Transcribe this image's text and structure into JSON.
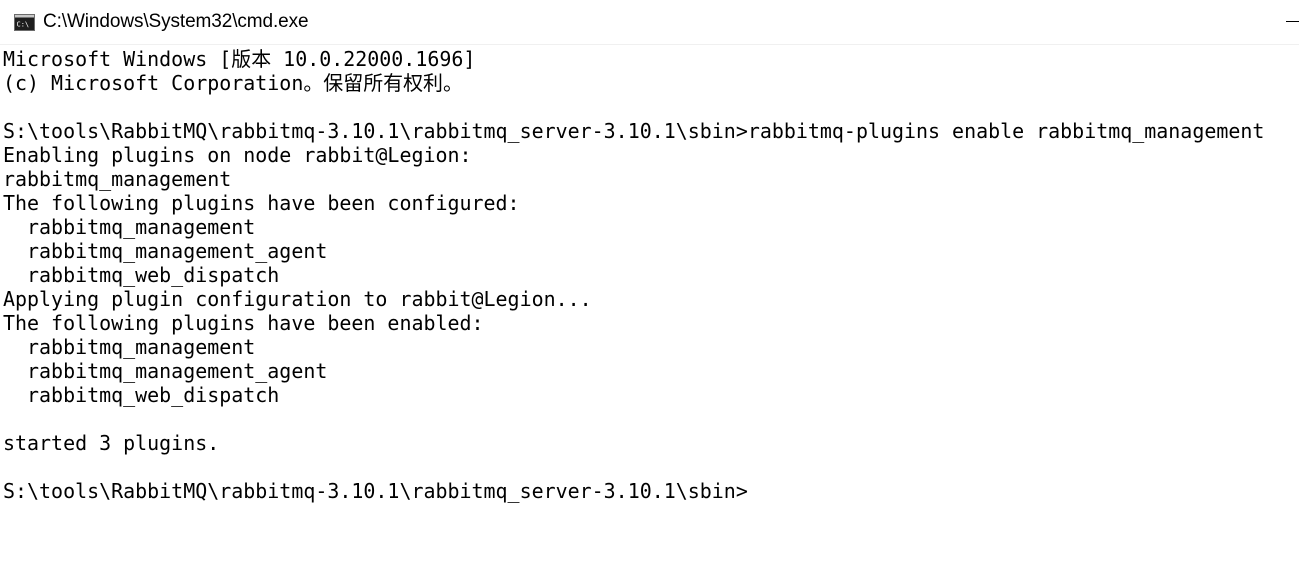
{
  "window": {
    "title": "C:\\Windows\\System32\\cmd.exe",
    "icon": "cmd-console-icon"
  },
  "console": {
    "lines": [
      "Microsoft Windows [版本 10.0.22000.1696]",
      "(c) Microsoft Corporation。保留所有权利。",
      "",
      "S:\\tools\\RabbitMQ\\rabbitmq-3.10.1\\rabbitmq_server-3.10.1\\sbin>rabbitmq-plugins enable rabbitmq_management",
      "Enabling plugins on node rabbit@Legion:",
      "rabbitmq_management",
      "The following plugins have been configured:",
      "  rabbitmq_management",
      "  rabbitmq_management_agent",
      "  rabbitmq_web_dispatch",
      "Applying plugin configuration to rabbit@Legion...",
      "The following plugins have been enabled:",
      "  rabbitmq_management",
      "  rabbitmq_management_agent",
      "  rabbitmq_web_dispatch",
      "",
      "started 3 plugins.",
      "",
      "S:\\tools\\RabbitMQ\\rabbitmq-3.10.1\\rabbitmq_server-3.10.1\\sbin>"
    ]
  }
}
